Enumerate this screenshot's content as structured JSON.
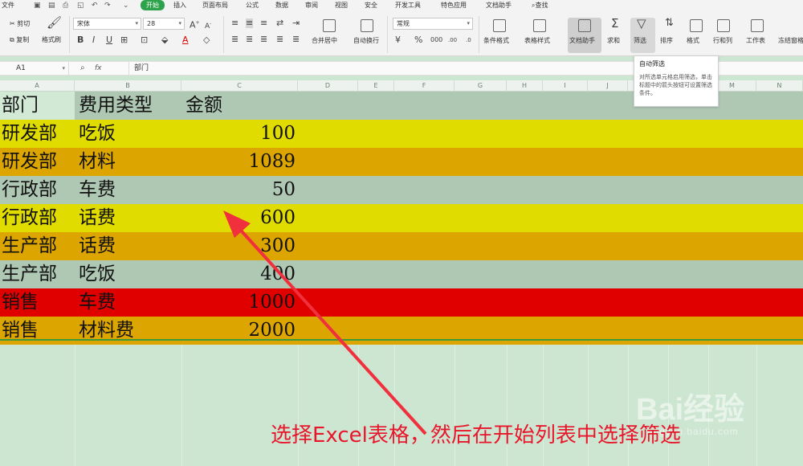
{
  "menu": {
    "file": "文件",
    "tabs": [
      "开始",
      "插入",
      "页面布局",
      "公式",
      "数据",
      "审阅",
      "视图",
      "安全",
      "开发工具",
      "特色应用",
      "文档助手"
    ],
    "search": "查找"
  },
  "ribbon": {
    "cut": "剪切",
    "copy": "复制",
    "format_painter": "格式刷",
    "font_name": "宋体",
    "font_size": "28",
    "merge_center": "合并居中",
    "wrap_text": "自动换行",
    "number_format": "常规",
    "conditional_format": "条件格式",
    "table_style": "表格样式",
    "doc_assistant": "文档助手",
    "sum": "求和",
    "filter": "筛选",
    "sort": "排序",
    "format": "格式",
    "row_col": "行和列",
    "worksheet": "工作表",
    "freeze": "冻结窗格"
  },
  "formula_bar": {
    "cell_ref": "A1",
    "fx_label": "fx",
    "value": "部门"
  },
  "columns": [
    "A",
    "B",
    "C",
    "D",
    "E",
    "F",
    "G",
    "H",
    "I",
    "J",
    "K",
    "L",
    "M",
    "N"
  ],
  "table": {
    "header": [
      "部门",
      "费用类型",
      "金额"
    ],
    "rows": [
      {
        "dept": "研发部",
        "type": "吃饭",
        "amount": "100",
        "color": "#e1dc00"
      },
      {
        "dept": "研发部",
        "type": "材料",
        "amount": "1089",
        "color": "#dda500"
      },
      {
        "dept": "行政部",
        "type": "车费",
        "amount": "50",
        "color": "#afc8b4"
      },
      {
        "dept": "行政部",
        "type": "话费",
        "amount": "600",
        "color": "#e1dc00"
      },
      {
        "dept": "生产部",
        "type": "话费",
        "amount": "300",
        "color": "#dda500"
      },
      {
        "dept": "生产部",
        "type": "吃饭",
        "amount": "400",
        "color": "#afc8b4"
      },
      {
        "dept": "销售",
        "type": "车费",
        "amount": "1000",
        "color": "#e00000"
      },
      {
        "dept": "销售",
        "type": "材料费",
        "amount": "2000",
        "color": "#dda500"
      }
    ],
    "header_color": "#afc8b4"
  },
  "tooltip": {
    "title": "自动筛选",
    "body": "对所选单元格启用筛选，单击标题中的箭头按钮可设置筛选条件。"
  },
  "caption": "选择Excel表格，然后在开始列表中选择筛选",
  "watermark": {
    "logo": "Bai经验",
    "sub": "jingyan.baidu.com"
  },
  "colors": {
    "accent": "#2ea24a",
    "caption": "#e8162a",
    "sheet_bg": "#cde6d2"
  }
}
